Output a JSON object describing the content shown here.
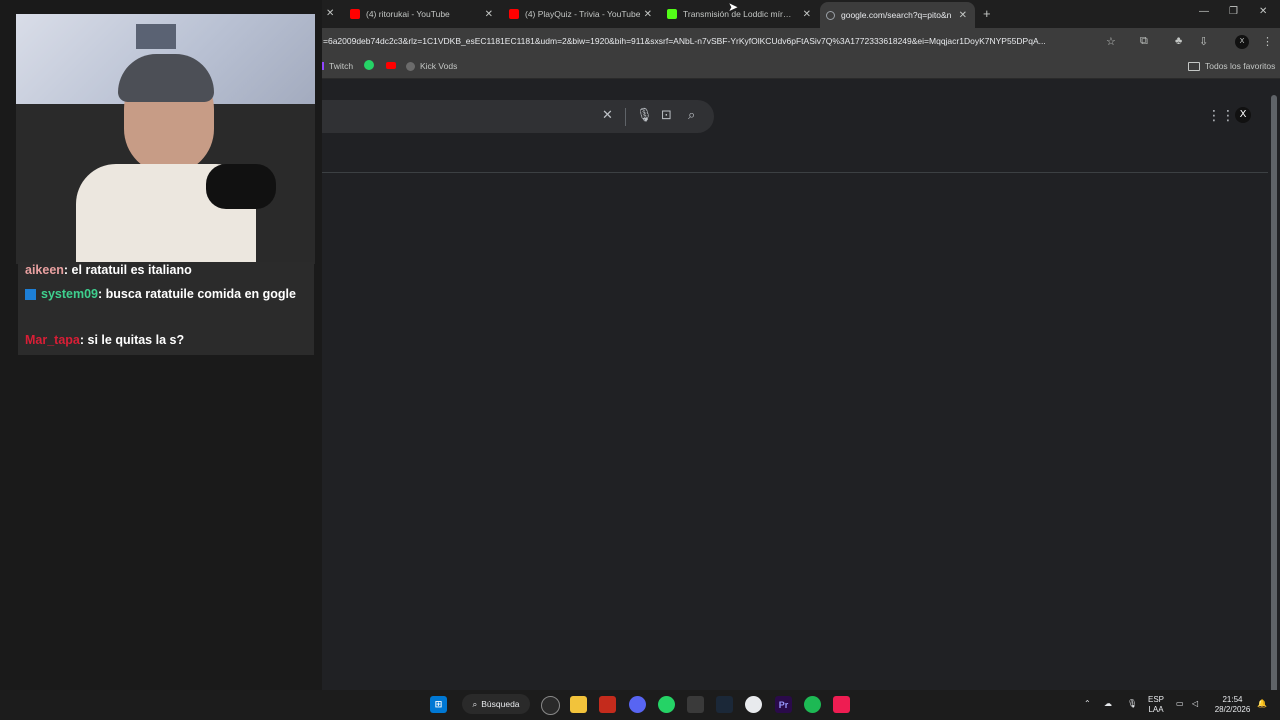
{
  "tabs": [
    {
      "title": "(4) ritorukai - YouTube",
      "favicon": "youtube-icon",
      "color": "#ff0000",
      "active": false
    },
    {
      "title": "(4) PlayQuiz - Trivia - YouTube",
      "favicon": "youtube-icon",
      "color": "#ff0000",
      "active": false
    },
    {
      "title": "Transmisión de Loddic mírala e",
      "favicon": "kick-icon",
      "color": "#53fc18",
      "active": false
    },
    {
      "title": "google.com/search?q=pito&n",
      "favicon": "google-icon",
      "color": "#9aa0a6",
      "active": true
    }
  ],
  "address_bar": {
    "url": "=6a2009deb74dc2c3&rlz=1C1VDKB_esEC1181EC1181&udm=2&biw=1920&bih=911&sxsrf=ANbL-n7vSBF-YrKyfOlKCUdv6pFtASiv7Q%3A1772333618249&ei=Mqqjacr1DoyK7NYP55DPqA..."
  },
  "bookmarks": {
    "items": [
      "Twitch",
      "Kick Vods"
    ],
    "all_favorites": "Todos los favoritos"
  },
  "chat": [
    {
      "user": "aikeen",
      "text": ": el ratatuil es italiano"
    },
    {
      "user": "system09",
      "text": ": busca ratatuile comida en gogle"
    },
    {
      "user": "Mar_tapa",
      "text": ": si le quitas la s?"
    }
  ],
  "taskbar": {
    "search_label": "Búsqueda",
    "lang_top": "ESP",
    "lang_bottom": "LAA",
    "time": "21:54",
    "date": "28/2/2026"
  },
  "colors": {
    "accent_red": "#d91e36",
    "accent_green": "#3ecf8e",
    "page_bg": "#202124"
  }
}
